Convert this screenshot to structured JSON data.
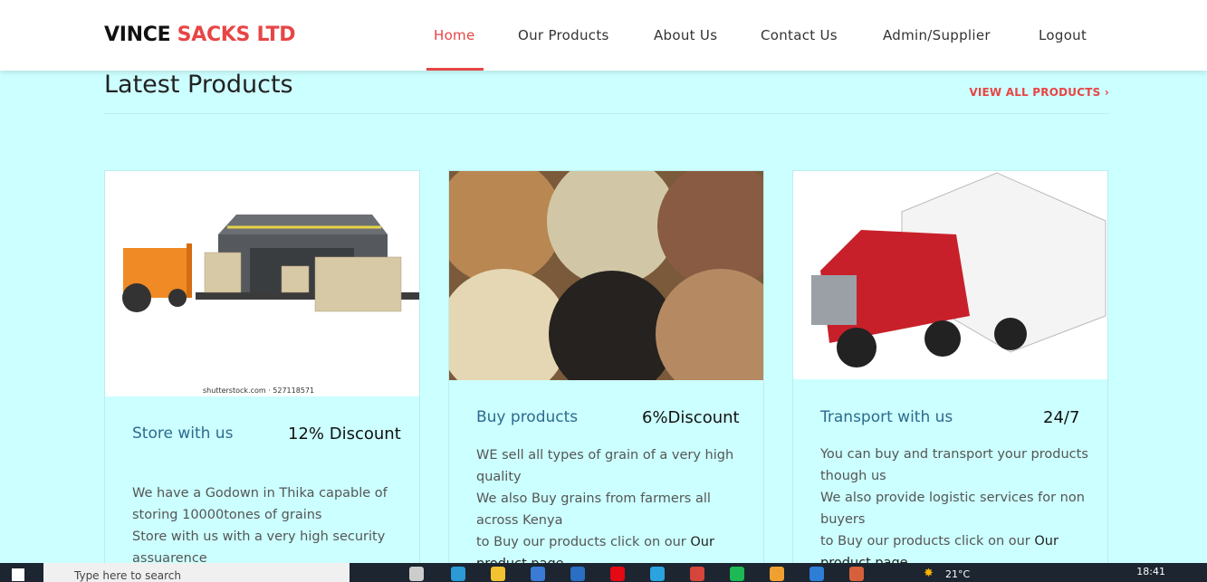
{
  "brand": {
    "part1": "VINCE ",
    "part2": "SACKS LTD",
    "accent_color": "#e84545"
  },
  "nav": {
    "items": [
      "Home",
      "Our Products",
      "About Us",
      "Contact Us",
      "Admin/Supplier",
      "Logout"
    ],
    "active": "Home"
  },
  "section": {
    "title": "Latest Products",
    "view_all": "VIEW ALL PRODUCTS",
    "view_all_icon": "chevron-right-icon"
  },
  "cards": [
    {
      "title": "Store with us",
      "badge": "12% Discount",
      "image_caption": "shutterstock.com · 527118571",
      "lines": [
        "We have a Godown in Thika capable of storing 10000tones of grains",
        "Store with us with a very high security assuarence"
      ]
    },
    {
      "title": "Buy products",
      "badge": "6%Discount",
      "lines": [
        "WE sell all types of grain of a very high quality",
        "We also Buy grains from farmers all across Kenya"
      ],
      "link_prefix": "to Buy our products click on our ",
      "link_text": "Our product page"
    },
    {
      "title": "Transport with us",
      "badge": "24/7",
      "lines": [
        "You can buy and transport your products though us",
        "We also provide logistic services for non buyers"
      ],
      "link_prefix": "to Buy our products click on our ",
      "link_text": "Our product page"
    }
  ],
  "taskbar": {
    "search_placeholder": "Type here to search",
    "weather": "21°C",
    "time": "18:41"
  }
}
